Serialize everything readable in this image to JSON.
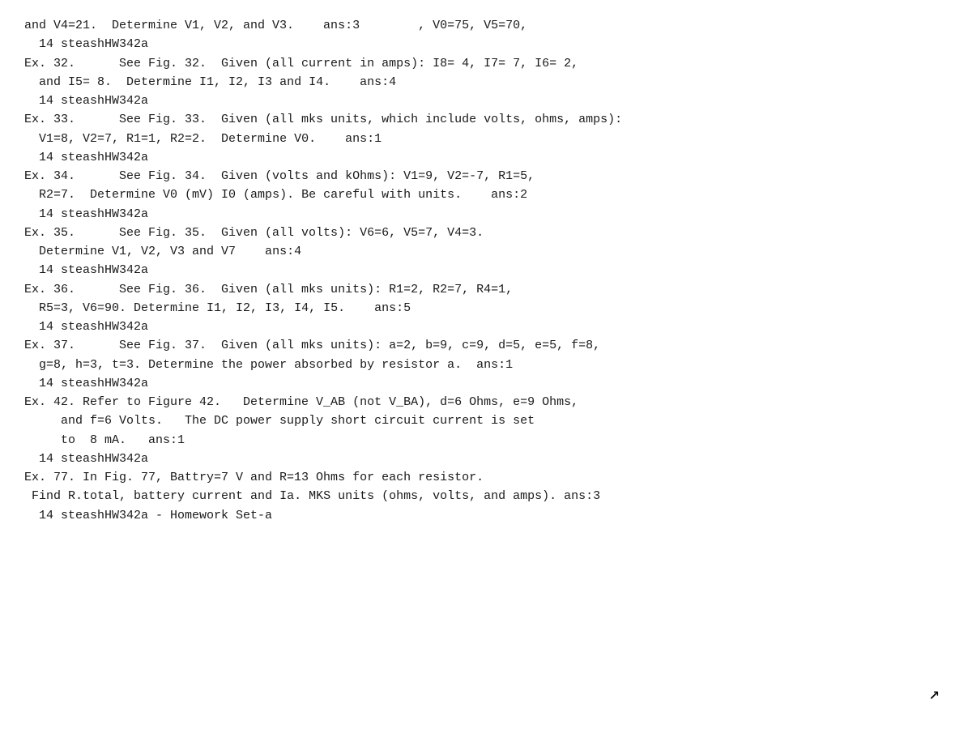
{
  "lines": [
    "and V4=21.  Determine V1, V2, and V3.    ans:3        , V0=75, V5=70,",
    "  14 steashHW342a",
    "Ex. 32.      See Fig. 32.  Given (all current in amps): I8= 4, I7= 7, I6= 2,",
    "  and I5= 8.  Determine I1, I2, I3 and I4.    ans:4",
    "  14 steashHW342a",
    "Ex. 33.      See Fig. 33.  Given (all mks units, which include volts, ohms, amps):",
    "  V1=8, V2=7, R1=1, R2=2.  Determine V0.    ans:1",
    "  14 steashHW342a",
    "Ex. 34.      See Fig. 34.  Given (volts and kOhms): V1=9, V2=-7, R1=5,",
    "  R2=7.  Determine V0 (mV) I0 (amps). Be careful with units.    ans:2",
    "  14 steashHW342a",
    "Ex. 35.      See Fig. 35.  Given (all volts): V6=6, V5=7, V4=3.",
    "  Determine V1, V2, V3 and V7    ans:4",
    "  14 steashHW342a",
    "Ex. 36.      See Fig. 36.  Given (all mks units): R1=2, R2=7, R4=1,",
    "  R5=3, V6=90. Determine I1, I2, I3, I4, I5.    ans:5",
    "  14 steashHW342a",
    "Ex. 37.      See Fig. 37.  Given (all mks units): a=2, b=9, c=9, d=5, e=5, f=8,",
    "  g=8, h=3, t=3. Determine the power absorbed by resistor a.  ans:1",
    "  14 steashHW342a",
    "Ex. 42. Refer to Figure 42.   Determine V_AB (not V_BA), d=6 Ohms, e=9 Ohms,",
    "     and f=6 Volts.   The DC power supply short circuit current is set",
    "     to  8 mA.   ans:1",
    "  14 steashHW342a",
    "Ex. 77. In Fig. 77, Battry=7 V and R=13 Ohms for each resistor.",
    " Find R.total, battery current and Ia. MKS units (ohms, volts, and amps). ans:3",
    "  14 steashHW342a - Homework Set-a"
  ]
}
